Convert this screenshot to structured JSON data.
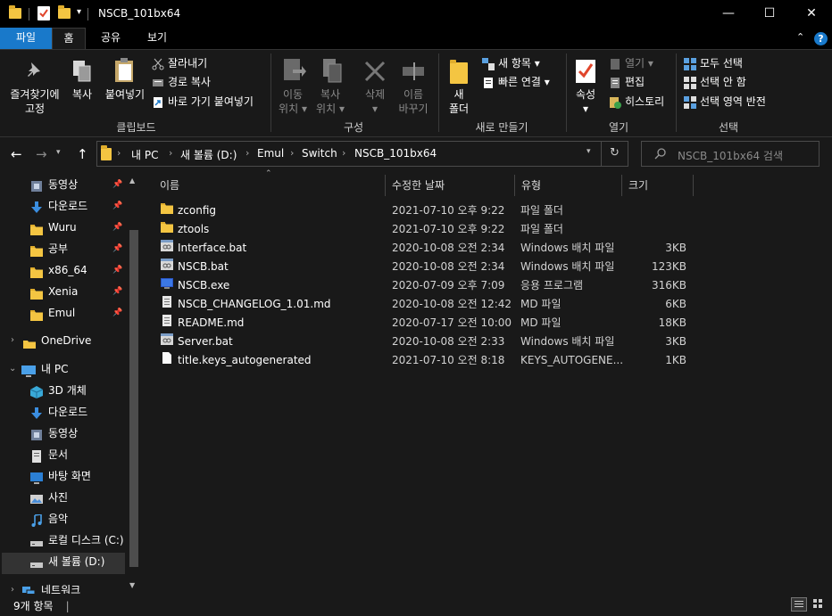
{
  "window": {
    "title": "NSCB_101bx64",
    "minimize": "—",
    "maximize": "☐",
    "close": "✕",
    "qat_dropdown": "▾"
  },
  "ribbon_tabs": [
    "파일",
    "홈",
    "공유",
    "보기"
  ],
  "ribbon": {
    "clipboard": {
      "pin_quick": "즐겨찾기에",
      "pin_quick2": "고정",
      "copy": "복사",
      "paste": "붙여넣기",
      "cut": "잘라내기",
      "copy_path": "경로 복사",
      "paste_shortcut": "바로 가기 붙여넣기",
      "label": "클립보드"
    },
    "organize": {
      "move_to": "이동",
      "move_to2": "위치",
      "copy_to": "복사",
      "copy_to2": "위치",
      "delete": "삭제",
      "rename": "이름",
      "rename2": "바꾸기",
      "label": "구성"
    },
    "new": {
      "new_folder": "새",
      "new_folder2": "폴더",
      "new_item": "새 항목",
      "easy_access": "빠른 연결",
      "label": "새로 만들기"
    },
    "open": {
      "properties": "속성",
      "open": "열기",
      "edit": "편집",
      "history": "히스토리",
      "label": "열기"
    },
    "select": {
      "select_all": "모두 선택",
      "select_none": "선택 안 함",
      "invert": "선택 영역 반전",
      "label": "선택"
    }
  },
  "address": {
    "crumbs": [
      "내 PC",
      "새 볼륨 (D:)",
      "Emul",
      "Switch",
      "NSCB_101bx64"
    ],
    "search_placeholder": "NSCB_101bx64 검색"
  },
  "nav": {
    "quick_access": [
      {
        "label": "동영상",
        "icon": "video-icon"
      },
      {
        "label": "다운로드",
        "icon": "download-icon"
      },
      {
        "label": "Wuru",
        "icon": "folder-icon"
      },
      {
        "label": "공부",
        "icon": "folder-icon"
      },
      {
        "label": "x86_64",
        "icon": "folder-icon"
      },
      {
        "label": "Xenia",
        "icon": "folder-icon"
      },
      {
        "label": "Emul",
        "icon": "folder-icon"
      }
    ],
    "onedrive": "OneDrive",
    "this_pc": "내 PC",
    "pc_items": [
      {
        "label": "3D 개체",
        "icon": "3d-objects-icon"
      },
      {
        "label": "다운로드",
        "icon": "download-icon"
      },
      {
        "label": "동영상",
        "icon": "video-icon"
      },
      {
        "label": "문서",
        "icon": "document-icon"
      },
      {
        "label": "바탕 화면",
        "icon": "desktop-icon"
      },
      {
        "label": "사진",
        "icon": "picture-icon"
      },
      {
        "label": "음악",
        "icon": "music-icon"
      },
      {
        "label": "로컬 디스크 (C:)",
        "icon": "drive-icon"
      },
      {
        "label": "새 볼륨 (D:)",
        "icon": "drive-icon"
      }
    ],
    "network": "네트워크"
  },
  "columns": {
    "name": "이름",
    "date": "수정한 날짜",
    "type": "유형",
    "size": "크기"
  },
  "files": [
    {
      "name": "zconfig",
      "date": "2021-07-10 오후 9:22",
      "type": "파일 폴더",
      "size": "",
      "icon": "folder-icon"
    },
    {
      "name": "ztools",
      "date": "2021-07-10 오후 9:22",
      "type": "파일 폴더",
      "size": "",
      "icon": "folder-icon"
    },
    {
      "name": "Interface.bat",
      "date": "2020-10-08 오전 2:34",
      "type": "Windows 배치 파일",
      "size": "3KB",
      "icon": "batch-file-icon"
    },
    {
      "name": "NSCB.bat",
      "date": "2020-10-08 오전 2:34",
      "type": "Windows 배치 파일",
      "size": "123KB",
      "icon": "batch-file-icon"
    },
    {
      "name": "NSCB.exe",
      "date": "2020-07-09 오후 7:09",
      "type": "응용 프로그램",
      "size": "316KB",
      "icon": "exe-icon"
    },
    {
      "name": "NSCB_CHANGELOG_1.01.md",
      "date": "2020-10-08 오전 12:42",
      "type": "MD 파일",
      "size": "6KB",
      "icon": "md-file-icon"
    },
    {
      "name": "README.md",
      "date": "2020-07-17 오전 10:00",
      "type": "MD 파일",
      "size": "18KB",
      "icon": "md-file-icon"
    },
    {
      "name": "Server.bat",
      "date": "2020-10-08 오전 2:33",
      "type": "Windows 배치 파일",
      "size": "3KB",
      "icon": "batch-file-icon"
    },
    {
      "name": "title.keys_autogenerated",
      "date": "2021-07-10 오전 8:18",
      "type": "KEYS_AUTOGENE...",
      "size": "1KB",
      "icon": "file-icon"
    }
  ],
  "status": {
    "count": "9개 항목"
  },
  "colors": {
    "accent": "#1979ca",
    "folder": "#f4c542",
    "background": "#191919",
    "titlebar": "#000000"
  }
}
